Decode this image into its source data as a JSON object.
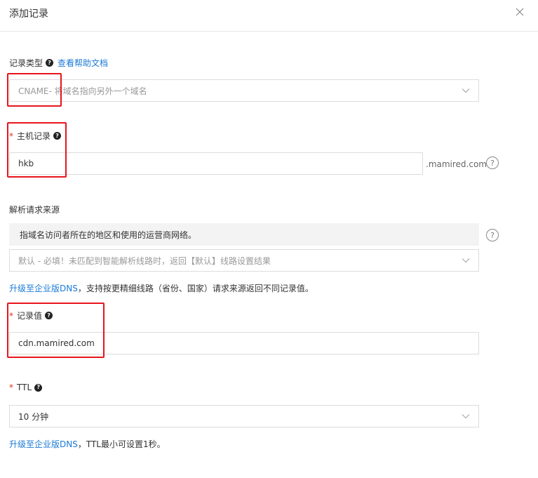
{
  "dialog": {
    "title": "添加记录"
  },
  "icons": {
    "close": "close-icon",
    "chevron": "chevron-down-icon",
    "help": "question-circle-icon"
  },
  "colors": {
    "link": "#1a7ad6",
    "required": "#e0301e",
    "highlight": "#e8141c"
  },
  "record_type": {
    "label": "记录类型",
    "help_link": "查看帮助文档",
    "value": "CNAME- 将域名指向另外一个域名"
  },
  "host": {
    "required_mark": "*",
    "label": "主机记录",
    "value": "hkb",
    "suffix": ".mamired.com"
  },
  "source": {
    "label": "解析请求来源",
    "info": "指域名访问者所在的地区和使用的运营商网络。",
    "value": "默认 - 必填！未匹配到智能解析线路时，返回【默认】线路设置结果",
    "upgrade_link": "升级至企业版DNS",
    "upgrade_text": "，支持按更精细线路（省份、国家）请求来源返回不同记录值。"
  },
  "record_value": {
    "required_mark": "*",
    "label": "记录值",
    "value": "cdn.mamired.com"
  },
  "ttl": {
    "required_mark": "*",
    "label": "TTL",
    "value": "10 分钟",
    "upgrade_link": "升级至企业版DNS",
    "upgrade_text": "，TTL最小可设置1秒。"
  },
  "help_glyph": "?"
}
